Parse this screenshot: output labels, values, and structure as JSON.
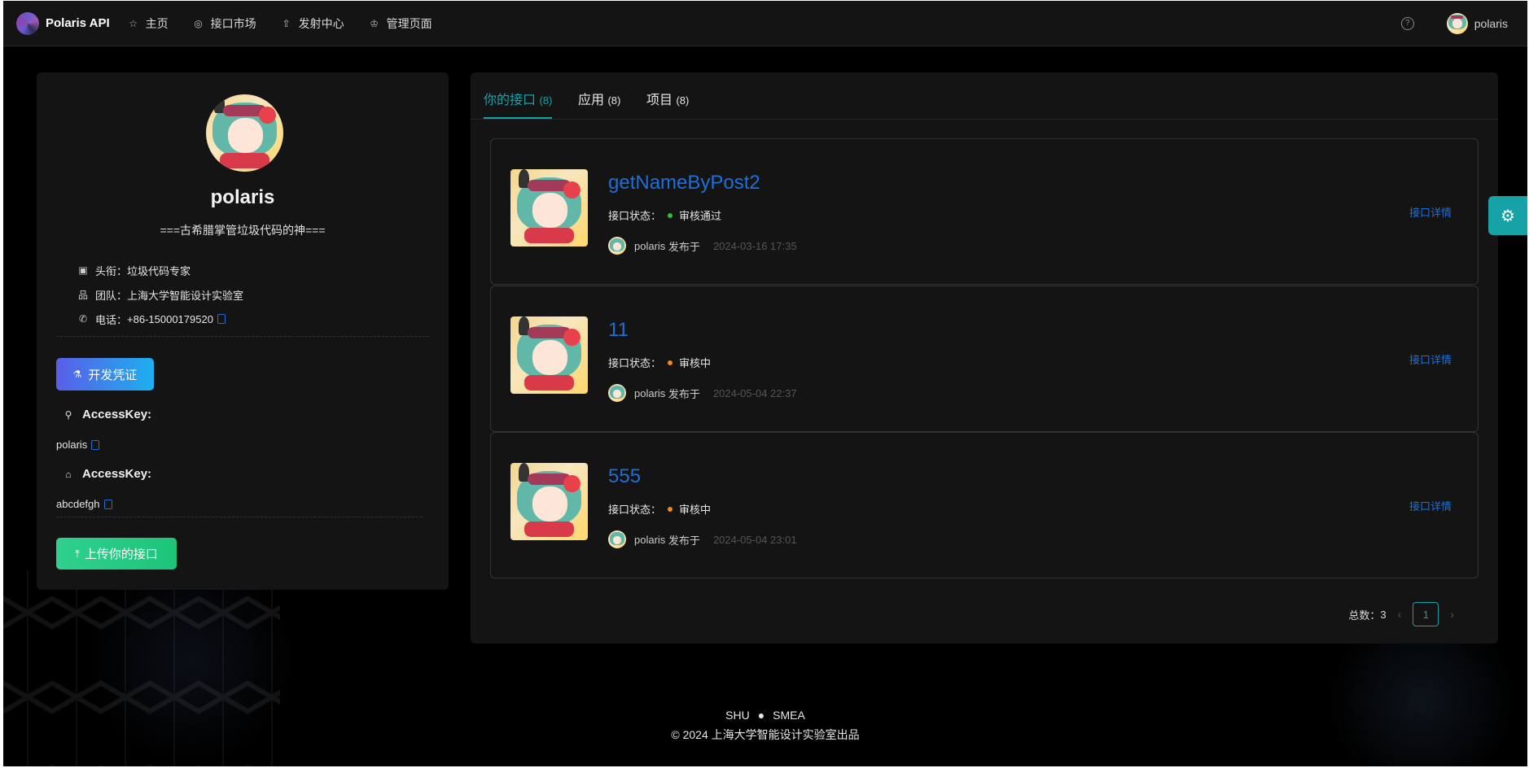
{
  "header": {
    "app_name": "Polaris API",
    "nav": [
      {
        "label": "主页",
        "icon": "star-icon"
      },
      {
        "label": "接口市场",
        "icon": "compass-icon"
      },
      {
        "label": "发射中心",
        "icon": "rocket-icon"
      },
      {
        "label": "管理页面",
        "icon": "crown-icon"
      }
    ],
    "username": "polaris"
  },
  "profile": {
    "name": "polaris",
    "motto": "===古希腊掌管垃圾代码的神===",
    "title_label": "头衔：",
    "title_value": "垃圾代码专家",
    "team_label": "团队：",
    "team_value": "上海大学智能设计实验室",
    "phone_label": "电话：",
    "phone_value": "+86-15000179520",
    "dev_button": "开发凭证",
    "access_key_label": "AccessKey:",
    "access_key_value": "polaris",
    "secret_key_label": "AccessKey:",
    "secret_key_value": "abcdefgh",
    "upload_button": "上传你的接口"
  },
  "tabs": [
    {
      "label": "你的接口",
      "count": "(8)",
      "active": true
    },
    {
      "label": "应用",
      "count": "(8)",
      "active": false
    },
    {
      "label": "项目",
      "count": "(8)",
      "active": false
    }
  ],
  "apis": [
    {
      "title": "getNameByPost2",
      "status_label": "接口状态：",
      "status": "审核通过",
      "status_color": "#2fbf3a",
      "author": "polaris",
      "published": "发布于",
      "time": "2024-03-16 17:35",
      "detail": "接口详情"
    },
    {
      "title": "11",
      "status_label": "接口状态：",
      "status": "审核中",
      "status_color": "#f08a24",
      "author": "polaris",
      "published": "发布于",
      "time": "2024-05-04 22:37",
      "detail": "接口详情"
    },
    {
      "title": "555",
      "status_label": "接口状态：",
      "status": "审核中",
      "status_color": "#f08a24",
      "author": "polaris",
      "published": "发布于",
      "time": "2024-05-04 23:01",
      "detail": "接口详情"
    }
  ],
  "pagination": {
    "total_label": "总数：",
    "total": "3",
    "current_page": "1"
  },
  "footer": {
    "left": "SHU",
    "right": "SMEA",
    "copyright": "© 2024 上海大学智能设计实验室出品"
  },
  "colors": {
    "accent": "#17a2a8",
    "link": "#1f6fd8"
  }
}
